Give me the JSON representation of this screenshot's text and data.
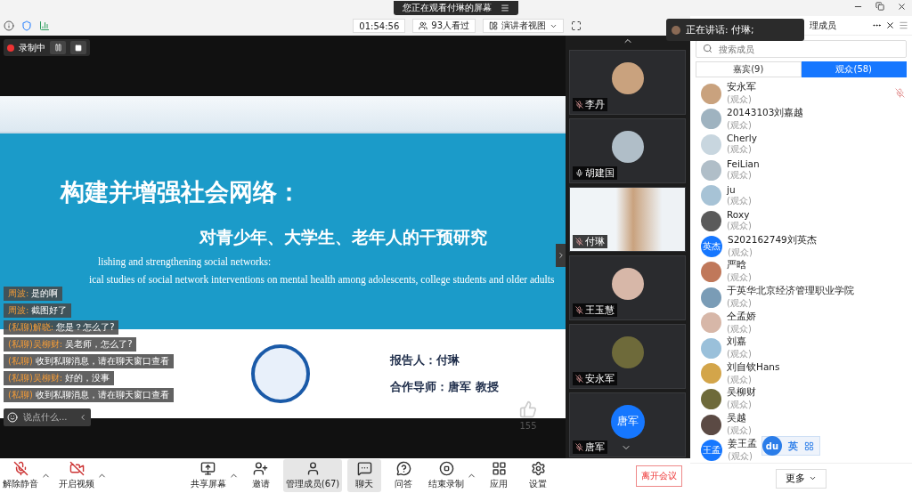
{
  "screen_banner": {
    "text": "您正在观看付琳的屏幕"
  },
  "toolbar": {
    "timer": "01:54:56",
    "viewers": "93人看过",
    "view_mode": "演讲者视图"
  },
  "speaking": {
    "text": "正在讲话: 付琳;"
  },
  "recording": {
    "label": "录制中"
  },
  "slide": {
    "title": "构建并增强社会网络：",
    "subtitle": "对青少年、大学生、老年人的干预研究",
    "english": [
      "lishing and strengthening social networks:",
      "ical studies of social network interventions on mental health among adolescents, college students and older adults"
    ],
    "presenter": "报告人：付琳",
    "advisor": "合作导师：唐军 教授"
  },
  "likes": {
    "count": "155"
  },
  "chat": {
    "messages": [
      {
        "sender": "周波:",
        "text": "是的啊"
      },
      {
        "sender": "周波:",
        "text": "截图好了"
      },
      {
        "sender": "(私聊)解晓:",
        "text": "您是？怎么了?"
      },
      {
        "sender": "(私聊)吴柳财:",
        "text": "吴老师，怎么了?"
      },
      {
        "sender": "(私聊)",
        "text": "收到私聊消息，请在聊天窗口查看"
      },
      {
        "sender": "(私聊)吴柳财:",
        "text": "好的，没事"
      },
      {
        "sender": "(私聊)",
        "text": "收到私聊消息，请在聊天窗口查看"
      }
    ],
    "placeholder": "说点什么..."
  },
  "thumbnails": [
    {
      "name": "李丹",
      "kind": "avatar",
      "muted": true
    },
    {
      "name": "胡建国",
      "kind": "avatar",
      "muted": false
    },
    {
      "name": "付琳",
      "kind": "video",
      "muted": true
    },
    {
      "name": "王玉慧",
      "kind": "avatar",
      "muted": true
    },
    {
      "name": "安永军",
      "kind": "avatar",
      "muted": true
    },
    {
      "name": "唐军",
      "kind": "initials",
      "initials": "唐军",
      "muted": true
    }
  ],
  "members": {
    "header": "理成员",
    "search": {
      "placeholder": "搜索成员"
    },
    "tabs": [
      {
        "label": "嘉宾(9)",
        "selected": false
      },
      {
        "label": "观众(58)",
        "selected": true
      }
    ],
    "items": [
      {
        "name": "安永军",
        "role": "(观众)",
        "kind": "photo",
        "muted": true
      },
      {
        "name": "20143103刘嘉越",
        "role": "(观众)",
        "kind": "photo",
        "muted": false
      },
      {
        "name": "Cherly",
        "role": "(观众)",
        "kind": "photo",
        "muted": false
      },
      {
        "name": "FeiLian",
        "role": "(观众)",
        "kind": "photo",
        "muted": false
      },
      {
        "name": "ju",
        "role": "(观众)",
        "kind": "photo",
        "muted": false
      },
      {
        "name": "Roxy",
        "role": "(观众)",
        "kind": "photo",
        "muted": false
      },
      {
        "name": "S202162749刘英杰",
        "role": "(观众)",
        "kind": "initials",
        "initials": "英杰",
        "muted": false
      },
      {
        "name": "严晗",
        "role": "(观众)",
        "kind": "photo",
        "muted": false
      },
      {
        "name": "于英华北京经济管理职业学院",
        "role": "(观众)",
        "kind": "photo",
        "muted": false
      },
      {
        "name": "仝孟娇",
        "role": "(观众)",
        "kind": "photo",
        "muted": false
      },
      {
        "name": "刘嘉",
        "role": "(观众)",
        "kind": "photo",
        "muted": false
      },
      {
        "name": "刘自钦Hans",
        "role": "(观众)",
        "kind": "photo",
        "muted": false
      },
      {
        "name": "吴柳财",
        "role": "(观众)",
        "kind": "photo",
        "muted": false
      },
      {
        "name": "吴越",
        "role": "(观众)",
        "kind": "photo",
        "muted": false
      },
      {
        "name": "姜王孟",
        "role": "(观众)",
        "kind": "initials",
        "initials": "王孟",
        "muted": false
      }
    ],
    "more": "更多"
  },
  "ime": {
    "logo": "du",
    "mode": "英"
  },
  "bottom_bar": {
    "items": [
      {
        "label": "解除静音",
        "kind": "mic-off",
        "caret": true,
        "selected": false
      },
      {
        "label": "开启视频",
        "kind": "video-off",
        "caret": true,
        "selected": false
      },
      {
        "label": "共享屏幕",
        "kind": "share",
        "caret": true,
        "selected": false
      },
      {
        "label": "邀请",
        "kind": "invite",
        "caret": false,
        "selected": false
      },
      {
        "label": "管理成员(67)",
        "kind": "members",
        "caret": false,
        "selected": true
      },
      {
        "label": "聊天",
        "kind": "chat",
        "caret": false,
        "selected": true
      },
      {
        "label": "问答",
        "kind": "qa",
        "caret": false,
        "selected": false
      },
      {
        "label": "结束录制",
        "kind": "record",
        "caret": true,
        "selected": false
      },
      {
        "label": "应用",
        "kind": "apps",
        "caret": false,
        "selected": false
      },
      {
        "label": "设置",
        "kind": "settings",
        "caret": false,
        "selected": false
      }
    ],
    "leave": "离开会议"
  }
}
